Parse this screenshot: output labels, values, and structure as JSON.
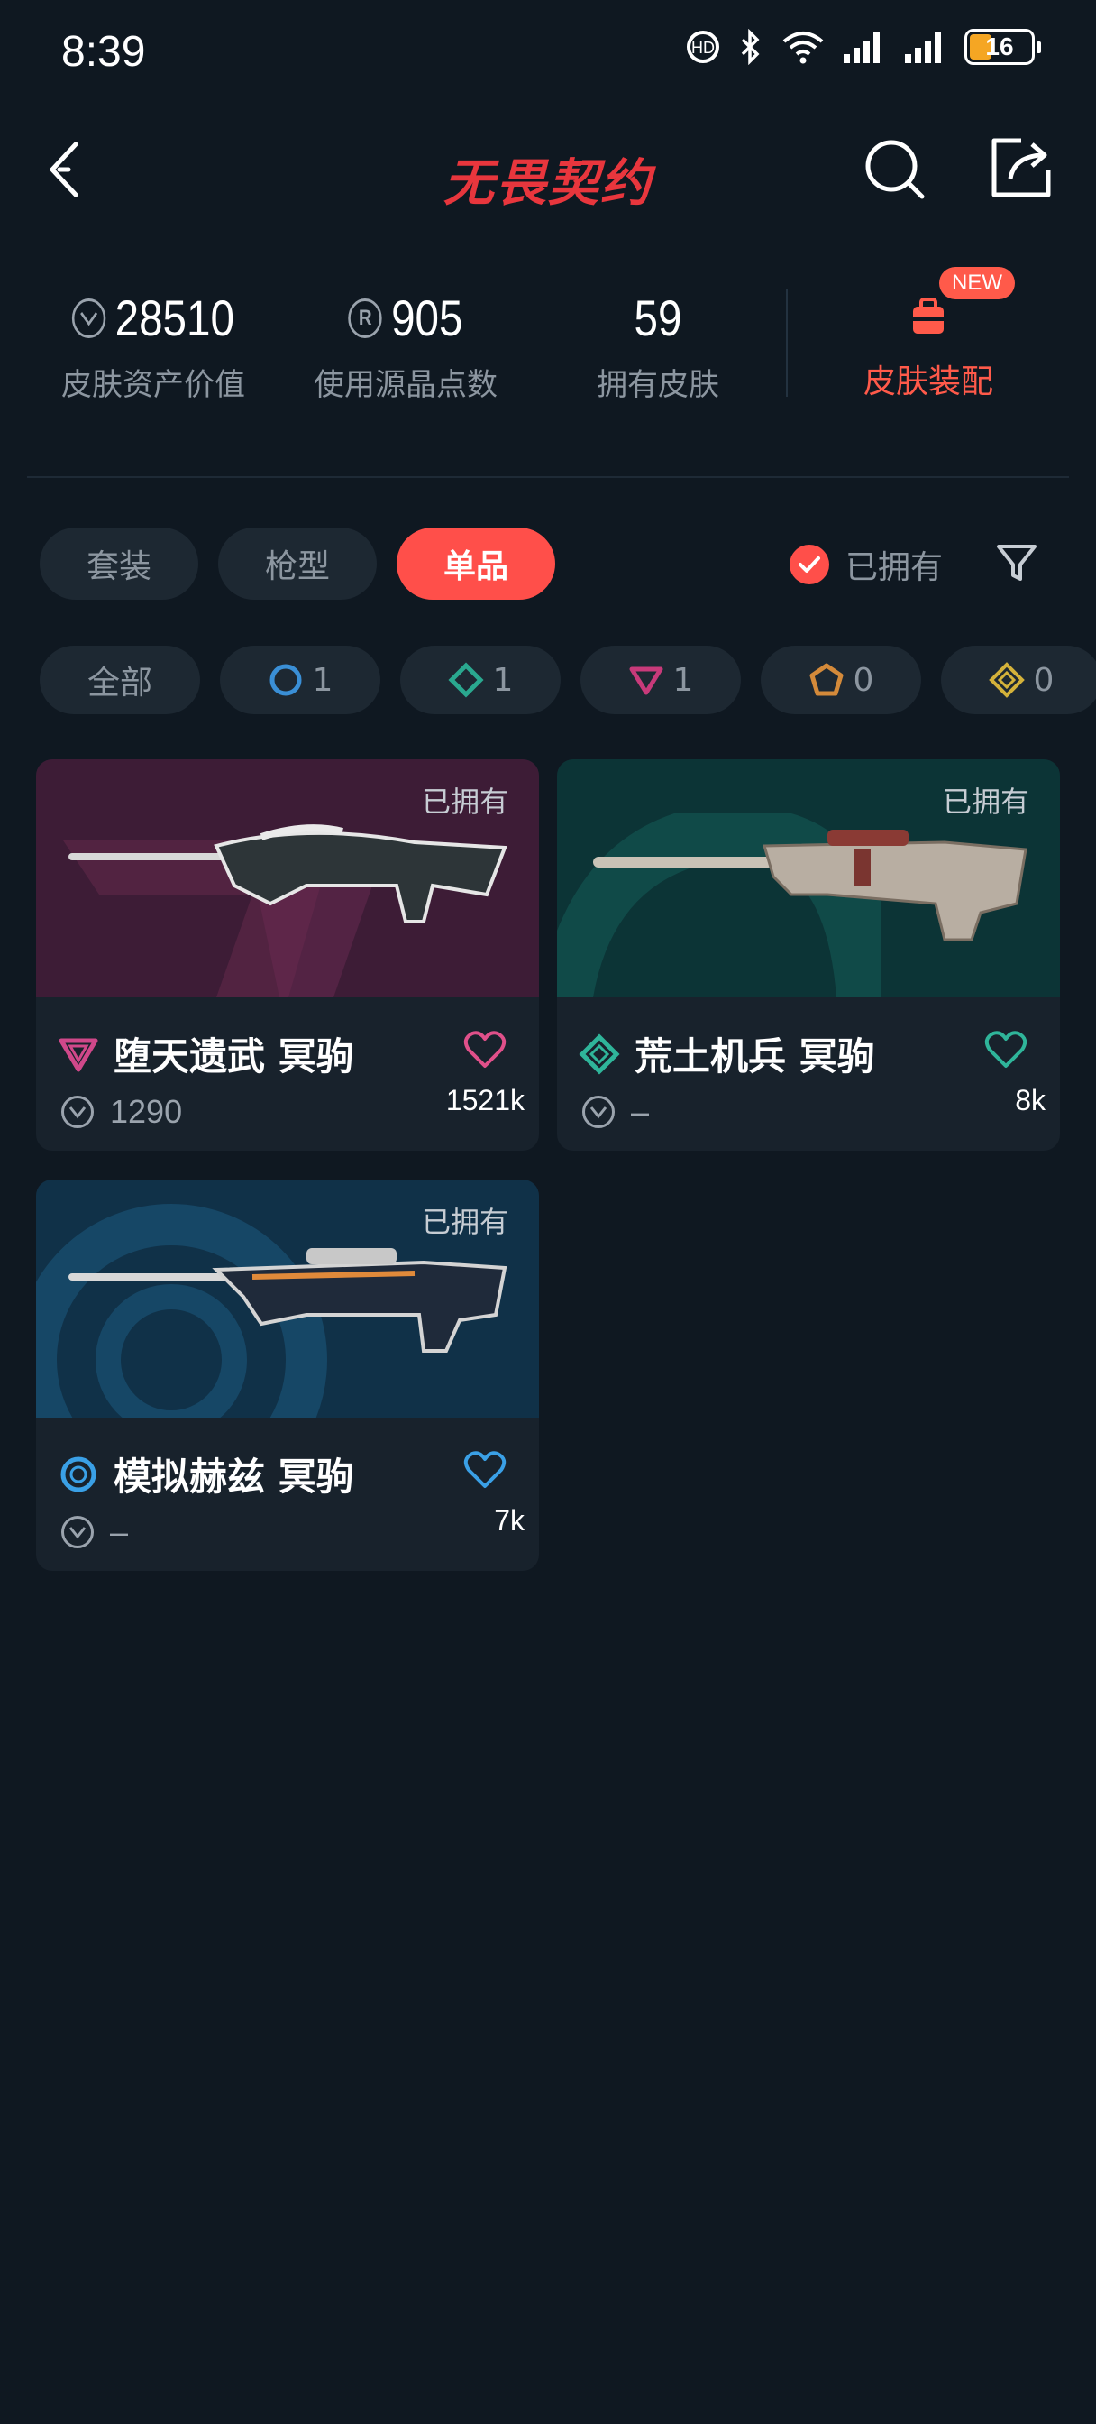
{
  "status_bar": {
    "time": "8:39",
    "battery": "16"
  },
  "header": {
    "title": "无畏契约"
  },
  "stats": {
    "asset_value": {
      "value": "28510",
      "label": "皮肤资产价值"
    },
    "radianite": {
      "value": "905",
      "label": "使用源晶点数"
    },
    "owned_skins": {
      "value": "59",
      "label": "拥有皮肤"
    },
    "equip": {
      "label": "皮肤装配",
      "badge": "NEW"
    }
  },
  "tabs": [
    {
      "label": "套装",
      "active": false
    },
    {
      "label": "枪型",
      "active": false
    },
    {
      "label": "单品",
      "active": true
    }
  ],
  "owned_filter": {
    "label": "已拥有",
    "checked": true
  },
  "rarity_chips": [
    {
      "label": "全部"
    },
    {
      "count": "1",
      "icon": "select-tier-icon",
      "color": "#3a8fd6"
    },
    {
      "count": "1",
      "icon": "deluxe-tier-icon",
      "color": "#2aa88f"
    },
    {
      "count": "1",
      "icon": "premium-tier-icon",
      "color": "#c83a7a"
    },
    {
      "count": "0",
      "icon": "exclusive-tier-icon",
      "color": "#d48a3a"
    },
    {
      "count": "0",
      "icon": "ultra-tier-icon",
      "color": "#d4b23a"
    }
  ],
  "cards": [
    {
      "name": "堕天遗武 冥驹",
      "owned_label": "已拥有",
      "price": "1290",
      "likes": "1521k",
      "tier_color": "#d0488a",
      "bg": "#4a2140",
      "heart_color": "#e0508a"
    },
    {
      "name": "荒土机兵 冥驹",
      "owned_label": "已拥有",
      "price": "–",
      "likes": "8k",
      "tier_color": "#2fb59a",
      "bg": "#0e3a3a",
      "heart_color": "#2fb59a"
    },
    {
      "name": "模拟赫兹 冥驹",
      "owned_label": "已拥有",
      "price": "–",
      "likes": "7k",
      "tier_color": "#3aa0e6",
      "bg": "#123a54",
      "heart_color": "#3aa0e6"
    }
  ]
}
